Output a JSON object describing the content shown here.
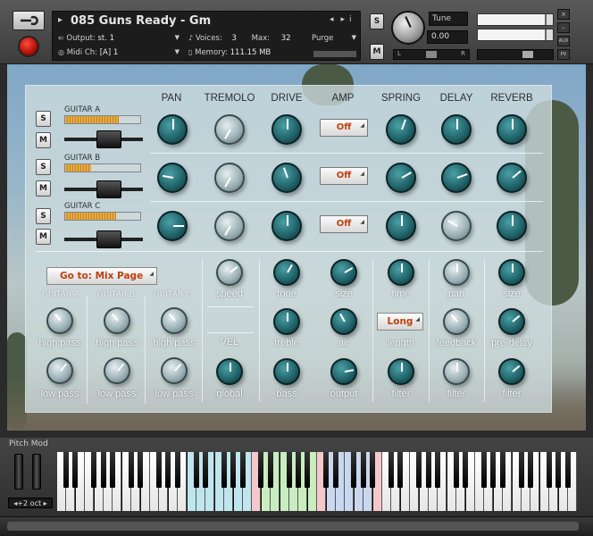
{
  "header": {
    "instrument_name": "085 Guns Ready - Gm",
    "output_label": "Output:",
    "output_value": "st. 1",
    "voices_label": "Voices:",
    "voices_value": "3",
    "max_label": "Max:",
    "max_value": "32",
    "purge_label": "Purge",
    "midi_label": "Midi Ch:",
    "midi_value": "[A]  1",
    "memory_label": "Memory:",
    "memory_value": "111.15 MB",
    "solo_label": "S",
    "mute_label": "M",
    "tune_label": "Tune",
    "tune_value": "0.00",
    "pan_left": "L",
    "pan_right": "R",
    "aux_label": "AUX",
    "pv_label": "PV",
    "close_label": "×",
    "min_label": "–"
  },
  "columns": [
    "PAN",
    "TREMOLO",
    "DRIVE",
    "AMP",
    "SPRING",
    "DELAY",
    "REVERB"
  ],
  "guitars": [
    {
      "name": "GUITAR A",
      "level": 0.72,
      "amp": "Off"
    },
    {
      "name": "GUITAR B",
      "level": 0.35,
      "amp": "Off"
    },
    {
      "name": "GUITAR C",
      "level": 0.68,
      "amp": "Off"
    }
  ],
  "solo_label": "S",
  "mute_label": "M",
  "goto_button": "Go to: Mix Page",
  "long_button": "Long",
  "vel_label": "VEL",
  "filter_section": {
    "headers": [
      "GUITAR A",
      "GUITAR B",
      "GUITAR C"
    ],
    "high_label": "high pass",
    "low_label": "low pass"
  },
  "knob_labels": {
    "speed": "speed",
    "global": "global",
    "tone": "tone",
    "size": "size",
    "treble": "treble",
    "air": "air",
    "bass": "bass",
    "output": "output",
    "time": "time",
    "length": "length",
    "filter": "filter",
    "pan": "pan",
    "feedback": "feedback",
    "pre_delay": "pre-delay"
  },
  "keyboard": {
    "pitch_mod_label": "Pitch Mod",
    "octave_label": "◂+2 oct ▸"
  },
  "colors": {
    "accent_orange": "#c04010",
    "knob_teal": "#1e6066",
    "meter_amber": "#e8a93e"
  }
}
